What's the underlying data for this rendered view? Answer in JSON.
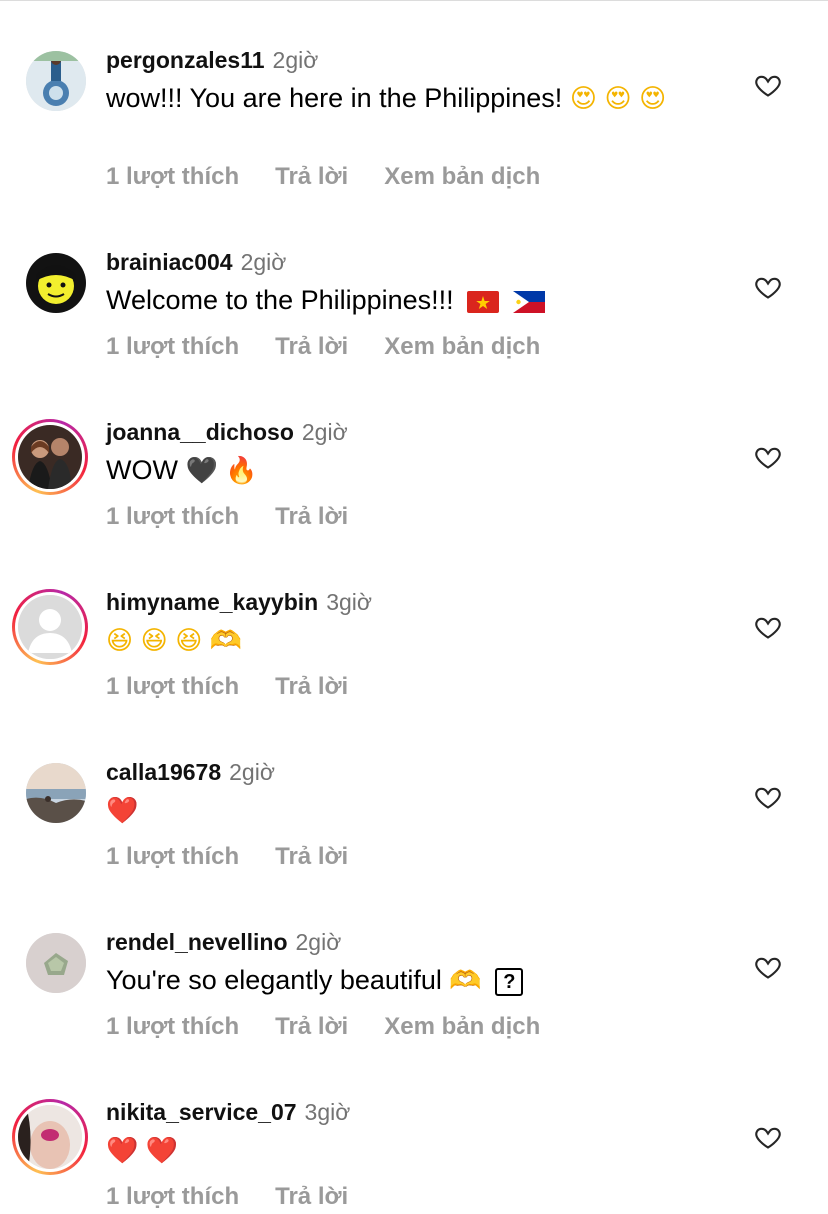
{
  "actions": {
    "like_count": "1 lượt thích",
    "reply": "Trả lời",
    "translate": "Xem bản dịch"
  },
  "comments": [
    {
      "username": "pergonzales11",
      "time": "2giờ",
      "text": "wow!!! You are here in the Philippines!",
      "emojis": [
        "😍",
        "😍",
        "😍"
      ],
      "has_story_ring": false,
      "has_translate": true
    },
    {
      "username": "brainiac004",
      "time": "2giờ",
      "text": "Welcome to the Philippines!!!",
      "emojis": [
        "vietnam-flag",
        "philippines-flag"
      ],
      "has_story_ring": false,
      "has_translate": true
    },
    {
      "username": "joanna__dichoso",
      "time": "2giờ",
      "text": "WOW",
      "emojis": [
        "🖤",
        "🔥"
      ],
      "has_story_ring": true,
      "has_translate": false
    },
    {
      "username": "himyname_kayybin",
      "time": "3giờ",
      "text": "",
      "emojis": [
        "😆",
        "😆",
        "😆",
        "🫶"
      ],
      "has_story_ring": true,
      "has_translate": false
    },
    {
      "username": "calla19678",
      "time": "2giờ",
      "text": "",
      "emojis": [
        "❤️"
      ],
      "has_story_ring": false,
      "has_translate": false
    },
    {
      "username": "rendel_nevellino",
      "time": "2giờ",
      "text": "You're so elegantly beautiful",
      "emojis": [
        "🫶",
        "?"
      ],
      "has_story_ring": false,
      "has_translate": true
    },
    {
      "username": "nikita_service_07",
      "time": "3giờ",
      "text": "",
      "emojis": [
        "❤️",
        "❤️"
      ],
      "has_story_ring": true,
      "has_translate": false
    }
  ],
  "icons": {
    "like": "heart-outline-icon",
    "story_ring_colors": [
      "#fec053",
      "#f2203e",
      "#b729a8"
    ]
  }
}
